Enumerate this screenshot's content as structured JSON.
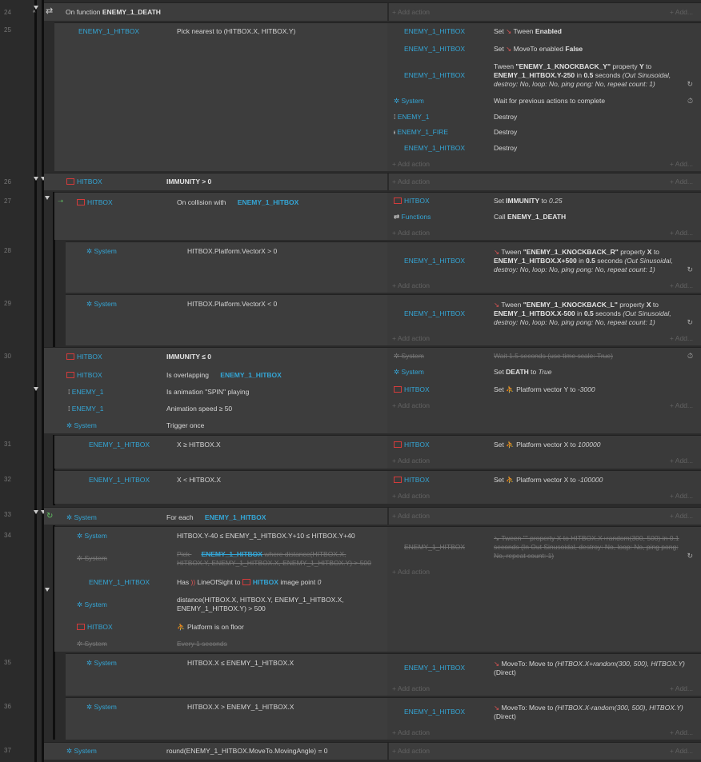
{
  "common": {
    "add_action": "Add action",
    "add_more": "Add..."
  },
  "lines": [
    "24",
    "25",
    "26",
    "27",
    "28",
    "29",
    "30",
    "31",
    "32",
    "33",
    "34",
    "35",
    "36",
    "37"
  ],
  "ev24": {
    "prefix": "On function",
    "name": "ENEMY_1_DEATH"
  },
  "ev25": {
    "cond_obj": "ENEMY_1_HITBOX",
    "cond_text": "Pick nearest to (HITBOX.X, HITBOX.Y)",
    "a1_obj": "ENEMY_1_HITBOX",
    "a1_pre": "Set",
    "a1_beh": "Tween",
    "a1_val": "Enabled",
    "a2_obj": "ENEMY_1_HITBOX",
    "a2_pre": "Set",
    "a2_beh": "MoveTo",
    "a2_mid": "enabled",
    "a2_val": "False",
    "a3_obj": "ENEMY_1_HITBOX",
    "a3_pre": "Tween",
    "a3_name": "\"ENEMY_1_KNOCKBACK_Y\"",
    "a3_mid": "property",
    "a3_prop": "Y",
    "a3_to": "to",
    "a3_expr": "ENEMY_1_HITBOX.Y-250",
    "a3_in": "in",
    "a3_dur": "0.5",
    "a3_sec": "seconds",
    "a3_opts": "(Out Sinusoidal, destroy: No, loop: No, ping pong: No, repeat count: 1)",
    "a4_obj": "System",
    "a4_text": "Wait for previous actions to complete",
    "a5_obj": "ENEMY_1",
    "a5_text": "Destroy",
    "a6_obj": "ENEMY_1_FIRE",
    "a6_text": "Destroy",
    "a7_obj": "ENEMY_1_HITBOX",
    "a7_text": "Destroy"
  },
  "ev26": {
    "cond_obj": "HITBOX",
    "cond_text": "IMMUNITY > 0"
  },
  "ev27": {
    "cond_obj": "HITBOX",
    "cond_text": "On collision with",
    "cond_target": "ENEMY_1_HITBOX",
    "a1_obj": "HITBOX",
    "a1_pre": "Set",
    "a1_var": "IMMUNITY",
    "a1_mid": "to",
    "a1_val": "0.25",
    "a2_obj": "Functions",
    "a2_pre": "Call",
    "a2_val": "ENEMY_1_DEATH"
  },
  "ev28": {
    "cond_obj": "System",
    "cond_text": "HITBOX.Platform.VectorX > 0",
    "a1_obj": "ENEMY_1_HITBOX",
    "a1_pre": "Tween",
    "a1_name": "\"ENEMY_1_KNOCKBACK_R\"",
    "a1_mid": "property",
    "a1_prop": "X",
    "a1_to": "to",
    "a1_expr": "ENEMY_1_HITBOX.X+500",
    "a1_in": "in",
    "a1_dur": "0.5",
    "a1_sec": "seconds",
    "a1_opts": "(Out Sinusoidal, destroy: No, loop: No, ping pong: No, repeat count: 1)"
  },
  "ev29": {
    "cond_obj": "System",
    "cond_text": "HITBOX.Platform.VectorX < 0",
    "a1_obj": "ENEMY_1_HITBOX",
    "a1_pre": "Tween",
    "a1_name": "\"ENEMY_1_KNOCKBACK_L\"",
    "a1_mid": "property",
    "a1_prop": "X",
    "a1_to": "to",
    "a1_expr": "ENEMY_1_HITBOX.X-500",
    "a1_in": "in",
    "a1_dur": "0.5",
    "a1_sec": "seconds",
    "a1_opts": "(Out Sinusoidal, destroy: No, loop: No, ping pong: No, repeat count: 1)"
  },
  "ev30": {
    "c1_obj": "HITBOX",
    "c1_text": "IMMUNITY ≤ 0",
    "c2_obj": "HITBOX",
    "c2_text": "Is overlapping",
    "c2_target": "ENEMY_1_HITBOX",
    "c3_obj": "ENEMY_1",
    "c3_text": "Is animation \"SPIN\" playing",
    "c4_obj": "ENEMY_1",
    "c4_text": "Animation speed ≥ 50",
    "c5_obj": "System",
    "c5_text": "Trigger once",
    "a1_obj": "System",
    "a1_text": "Wait 1.5 seconds (use time scale: True)",
    "a2_obj": "System",
    "a2_pre": "Set",
    "a2_var": "DEATH",
    "a2_mid": "to",
    "a2_val": "True",
    "a3_obj": "HITBOX",
    "a3_pre": "Set",
    "a3_text": "Platform vector Y to",
    "a3_val": "-3000"
  },
  "ev31": {
    "cond_obj": "ENEMY_1_HITBOX",
    "cond_text": "X ≥ HITBOX.X",
    "a1_obj": "HITBOX",
    "a1_pre": "Set",
    "a1_text": "Platform vector X to",
    "a1_val": "100000"
  },
  "ev32": {
    "cond_obj": "ENEMY_1_HITBOX",
    "cond_text": "X < HITBOX.X",
    "a1_obj": "HITBOX",
    "a1_pre": "Set",
    "a1_text": "Platform vector X to",
    "a1_val": "-100000"
  },
  "ev33": {
    "cond_obj": "System",
    "cond_text": "For each",
    "cond_target": "ENEMY_1_HITBOX"
  },
  "ev34": {
    "c1_obj": "System",
    "c1_text": "HITBOX.Y-40 ≤ ENEMY_1_HITBOX.Y+10 ≤ HITBOX.Y+40",
    "c2_obj": "System",
    "c2_pre": "Pick",
    "c2_target": "ENEMY_1_HITBOX",
    "c2_text": "where distance(HITBOX.X, HITBOX.Y, ENEMY_1_HITBOX.X, ENEMY_1_HITBOX.Y) > 500",
    "c3_obj": "ENEMY_1_HITBOX",
    "c3_pre": "Has",
    "c3_beh": "LineOfSight",
    "c3_mid": "to",
    "c3_target": "HITBOX",
    "c3_post": "image point",
    "c3_val": "0",
    "c4_obj": "System",
    "c4_text": "distance(HITBOX.X, HITBOX.Y, ENEMY_1_HITBOX.X, ENEMY_1_HITBOX.Y) > 500",
    "c5_obj": "HITBOX",
    "c5_text": "Platform is on floor",
    "c6_obj": "System",
    "c6_text": "Every 1 seconds",
    "a1_obj": "ENEMY_1_HITBOX",
    "a1_text": "Tween \"\" property X to HITBOX.X+random(300, 500) in 0.1 seconds (In Out Sinusoidal, destroy: No, loop: No, ping pong: No, repeat count: 1)"
  },
  "ev35": {
    "cond_obj": "System",
    "cond_text": "HITBOX.X ≤ ENEMY_1_HITBOX.X",
    "a1_obj": "ENEMY_1_HITBOX",
    "a1_pre": "MoveTo: Move to",
    "a1_expr": "(HITBOX.X+random(300, 500), HITBOX.Y)",
    "a1_post": "(Direct)"
  },
  "ev36": {
    "cond_obj": "System",
    "cond_text": "HITBOX.X > ENEMY_1_HITBOX.X",
    "a1_obj": "ENEMY_1_HITBOX",
    "a1_pre": "MoveTo: Move to",
    "a1_expr": "(HITBOX.X-random(300, 500), HITBOX.Y)",
    "a1_post": "(Direct)"
  },
  "ev37": {
    "cond_obj": "System",
    "cond_text": "round(ENEMY_1_HITBOX.MoveTo.MovingAngle) = 0"
  }
}
